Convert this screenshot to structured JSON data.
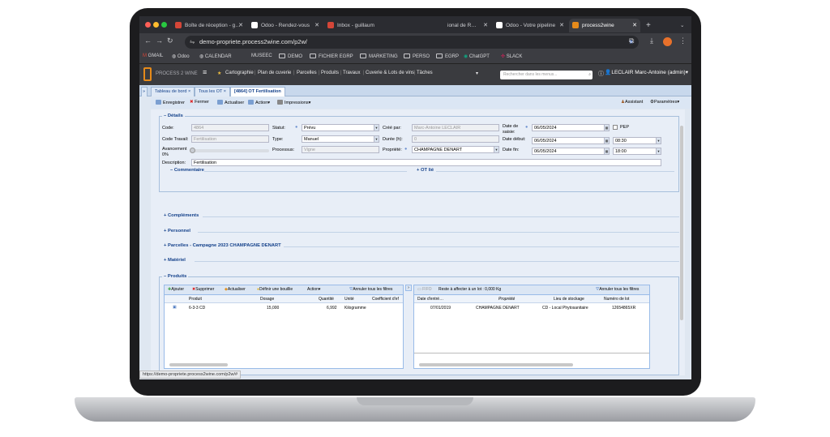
{
  "browser": {
    "tabs": [
      {
        "label": "Boîte de réception - g…",
        "icon_color": "#d44638"
      },
      {
        "label": "Odoo - Rendez-vous",
        "icon_color": "#ffffff"
      },
      {
        "label": "Inbox - guillaum",
        "icon_color": "#d44638"
      },
      {
        "label": "ional de R…",
        "icon_color": "#cfd0d4"
      },
      {
        "label": "Odoo - Votre pipeline",
        "icon_color": "#ffffff"
      },
      {
        "label": "process2wine",
        "icon_color": "#e58a1a"
      }
    ],
    "url": "demo-propriete.process2wine.com/p2w/",
    "bookmarks": [
      "GMAIL",
      "Odoo",
      "CALENDAR",
      "MUSEEC",
      "DEMO",
      "FICHIER EGRP",
      "MARKETING",
      "PERSO",
      "EGRP",
      "ChatGPT",
      "SLACK"
    ]
  },
  "app": {
    "logo_text": "PROCESS 2 WINE",
    "menu": [
      "Cartographie",
      "Plan de cuverie",
      "Parcelles",
      "Produits",
      "Travaux",
      "Cuverie & Lots de vins",
      "Tâches"
    ],
    "search_placeholder": "Rechercher dans les menus...",
    "user": "LECLAIR Marc-Antoine (admin)",
    "open_tabs": [
      "Tableau de bord",
      "Tous les OT",
      "[4864] OT Fertilisation"
    ]
  },
  "toolbar": {
    "save": "Enregistrer",
    "close": "Fermer",
    "refresh": "Actualiser",
    "action": "Action",
    "print": "Impressions",
    "assistant": "Assistant",
    "settings": "Paramètres"
  },
  "details": {
    "legend": "Détails",
    "code_label": "Code:",
    "code": "4864",
    "code_travail_label": "Code Travail:",
    "code_travail": "Fertilisation",
    "avancement_label": "Avancement",
    "avancement": "0%",
    "statut_label": "Statut:",
    "statut": "Prévu",
    "type_label": "Type:",
    "type": "Manuel",
    "processus_label": "Processus:",
    "processus": "Vigne",
    "cree_label": "Créé par:",
    "cree": "Marc-Antoine LECLAIR",
    "duree_label": "Durée (h):",
    "duree": "0",
    "propriete_label": "Propriété:",
    "propriete": "CHAMPAGNE DENART",
    "date_saisie_label": "Date de saisie:",
    "date_saisie": "06/05/2024",
    "pep": "PEP",
    "date_debut_label": "Date début:",
    "date_debut": "06/05/2024",
    "heure_debut": "08:30",
    "date_fin_label": "Date fin:",
    "date_fin": "06/05/2024",
    "heure_fin": "18:00",
    "description_label": "Description:",
    "description": "Fertilisation",
    "commentaire": "Commentaire",
    "ot_lie": "OT lié"
  },
  "sections": [
    "Compléments",
    "Personnel",
    "Parcelles - Campagne 2023 CHAMPAGNE DENART",
    "Matériel",
    "Produits"
  ],
  "produits": {
    "toolbar": [
      "Ajouter",
      "Supprimer",
      "Actualiser",
      "Définir une bouillie",
      "Action",
      "Annuler tous les filtres"
    ],
    "columns": [
      "Produit",
      "Dosage",
      "Quantité",
      "Unité",
      "Coefficient d'ef"
    ],
    "rows": [
      [
        "6-3-3 CD",
        "15,000",
        "6,992",
        "Kilogramme",
        ""
      ]
    ]
  },
  "lots": {
    "fifo": "FIFO",
    "reste": "Reste à affecter à un lot : 0,000 Kg",
    "clear_filters": "Annuler tous les filtres",
    "columns": [
      "Date d'entré…",
      "Propriété",
      "Lieu de stockage",
      "Numéro de lot"
    ],
    "rows": [
      [
        "07/01/2019",
        "CHAMPAGNE DENART",
        "CD - Local Phytosanitaire",
        "12654865XR"
      ]
    ]
  },
  "status_url": "https://demo-propriete.process2wine.com/p2w/#"
}
